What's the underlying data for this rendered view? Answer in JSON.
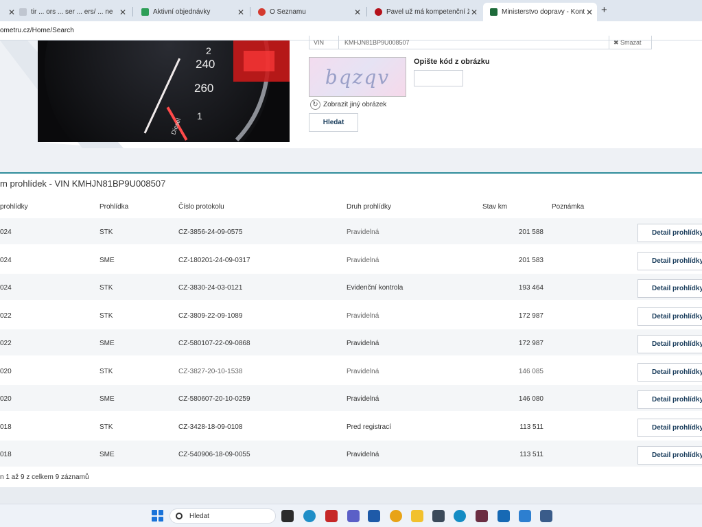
{
  "browser": {
    "tabs": [
      {
        "title": "tir ... ors ... ser ... ers/ ... ne",
        "color": "#c0c6d0",
        "active": false
      },
      {
        "title": "Aktivní objednávky",
        "color": "#2e9e57",
        "active": false
      },
      {
        "title": "O Seznamu",
        "color": "#d43a2f",
        "active": false
      },
      {
        "title": "Pavel už má kompetenční žalob",
        "color": "#b5121b",
        "active": false
      },
      {
        "title": "Ministerstvo dopravy - Kontrol",
        "color": "#1e6b3a",
        "active": true
      }
    ],
    "new_tab_label": "+",
    "close_label": "✕",
    "url": "ometru.cz/Home/Search"
  },
  "form": {
    "vin_label": "VIN",
    "vin_value": "KMHJN81BP9U008507",
    "clear_label": "✖ Smazat",
    "captcha_text": "bqzqv",
    "captcha_label": "Opište kód z obrázku",
    "captcha_input_value": "",
    "refresh_label": "Zobrazit jiný obrázek",
    "search_button": "Hledat"
  },
  "gauge": {
    "ticks": [
      "240",
      "260",
      "1",
      "2"
    ],
    "fuel_label": "Diesel",
    "fuel_fraction": "1/2"
  },
  "results": {
    "title": "m prohlídek - VIN KMHJN81BP9U008507",
    "columns": [
      "prohlídky",
      "Prohlídka",
      "Číslo protokolu",
      "Druh prohlídky",
      "Stav km",
      "Poznámka"
    ],
    "detail_label": "Detail prohlídky",
    "rows": [
      {
        "date": "024",
        "type": "STK",
        "protocol": "CZ-3856-24-09-0575",
        "kind": "Pravidelná",
        "km": "201 588",
        "note": ""
      },
      {
        "date": "024",
        "type": "SME",
        "protocol": "CZ-180201-24-09-0317",
        "kind": "Pravidelná",
        "km": "201 583",
        "note": ""
      },
      {
        "date": "024",
        "type": "STK",
        "protocol": "CZ-3830-24-03-0121",
        "kind": "Evidenční kontrola",
        "km": "193 464",
        "note": ""
      },
      {
        "date": "022",
        "type": "STK",
        "protocol": "CZ-3809-22-09-1089",
        "kind": "Pravidelná",
        "km": "172 987",
        "note": ""
      },
      {
        "date": "022",
        "type": "SME",
        "protocol": "CZ-580107-22-09-0868",
        "kind": "Pravidelná",
        "km": "172 987",
        "note": ""
      },
      {
        "date": "020",
        "type": "STK",
        "protocol": "CZ-3827-20-10-1538",
        "kind": "Pravidelná",
        "km": "146 085",
        "note": ""
      },
      {
        "date": "020",
        "type": "SME",
        "protocol": "CZ-580607-20-10-0259",
        "kind": "Pravidelná",
        "km": "146 080",
        "note": ""
      },
      {
        "date": "018",
        "type": "STK",
        "protocol": "CZ-3428-18-09-0108",
        "kind": "Pred registrací",
        "km": "113 511",
        "note": ""
      },
      {
        "date": "018",
        "type": "SME",
        "protocol": "CZ-540906-18-09-0055",
        "kind": "Pravidelná",
        "km": "113 511",
        "note": ""
      }
    ],
    "summary": "n 1 až 9 z celkem 9 záznamů"
  },
  "taskbar": {
    "search_placeholder": "Hledat",
    "apps": [
      {
        "name": "file-explorer-icon",
        "color": "#2b2b2b"
      },
      {
        "name": "edge-dev-icon",
        "color": "#1f8ec7"
      },
      {
        "name": "app-red-icon",
        "color": "#c62828"
      },
      {
        "name": "teams-icon",
        "color": "#5b5fc7"
      },
      {
        "name": "store-icon",
        "color": "#1e5aa8"
      },
      {
        "name": "chrome-icon",
        "color": "#e8a317"
      },
      {
        "name": "folder-icon",
        "color": "#f2c12e"
      },
      {
        "name": "app-tool-icon",
        "color": "#3b4a5a"
      },
      {
        "name": "edge-icon",
        "color": "#148cc4"
      },
      {
        "name": "app-game-icon",
        "color": "#6b2d42"
      },
      {
        "name": "vscode-icon",
        "color": "#1769b4"
      },
      {
        "name": "settings-icon",
        "color": "#2d7fd0"
      },
      {
        "name": "app-misc-icon",
        "color": "#3a5c8a"
      }
    ]
  }
}
